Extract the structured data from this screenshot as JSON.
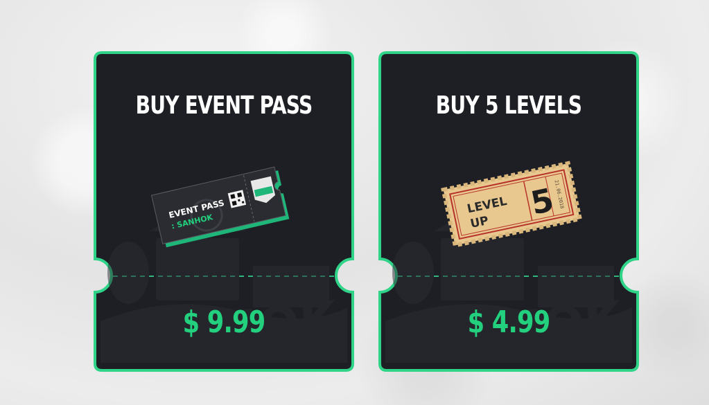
{
  "cards": [
    {
      "title": "BUY EVENT PASS",
      "price": "$ 9.99",
      "item": {
        "line1": "EVENT PASS",
        "line2": ": SANHOK"
      }
    },
    {
      "title": "BUY 5 LEVELS",
      "price": "$ 4.99",
      "item": {
        "line1": "LEVEL",
        "line2": "UP",
        "number": "5",
        "date": "21.06.2018"
      }
    }
  ],
  "colors": {
    "accent": "#22d07e",
    "card_bg": "#1e1f24",
    "border": "#2fd489"
  }
}
